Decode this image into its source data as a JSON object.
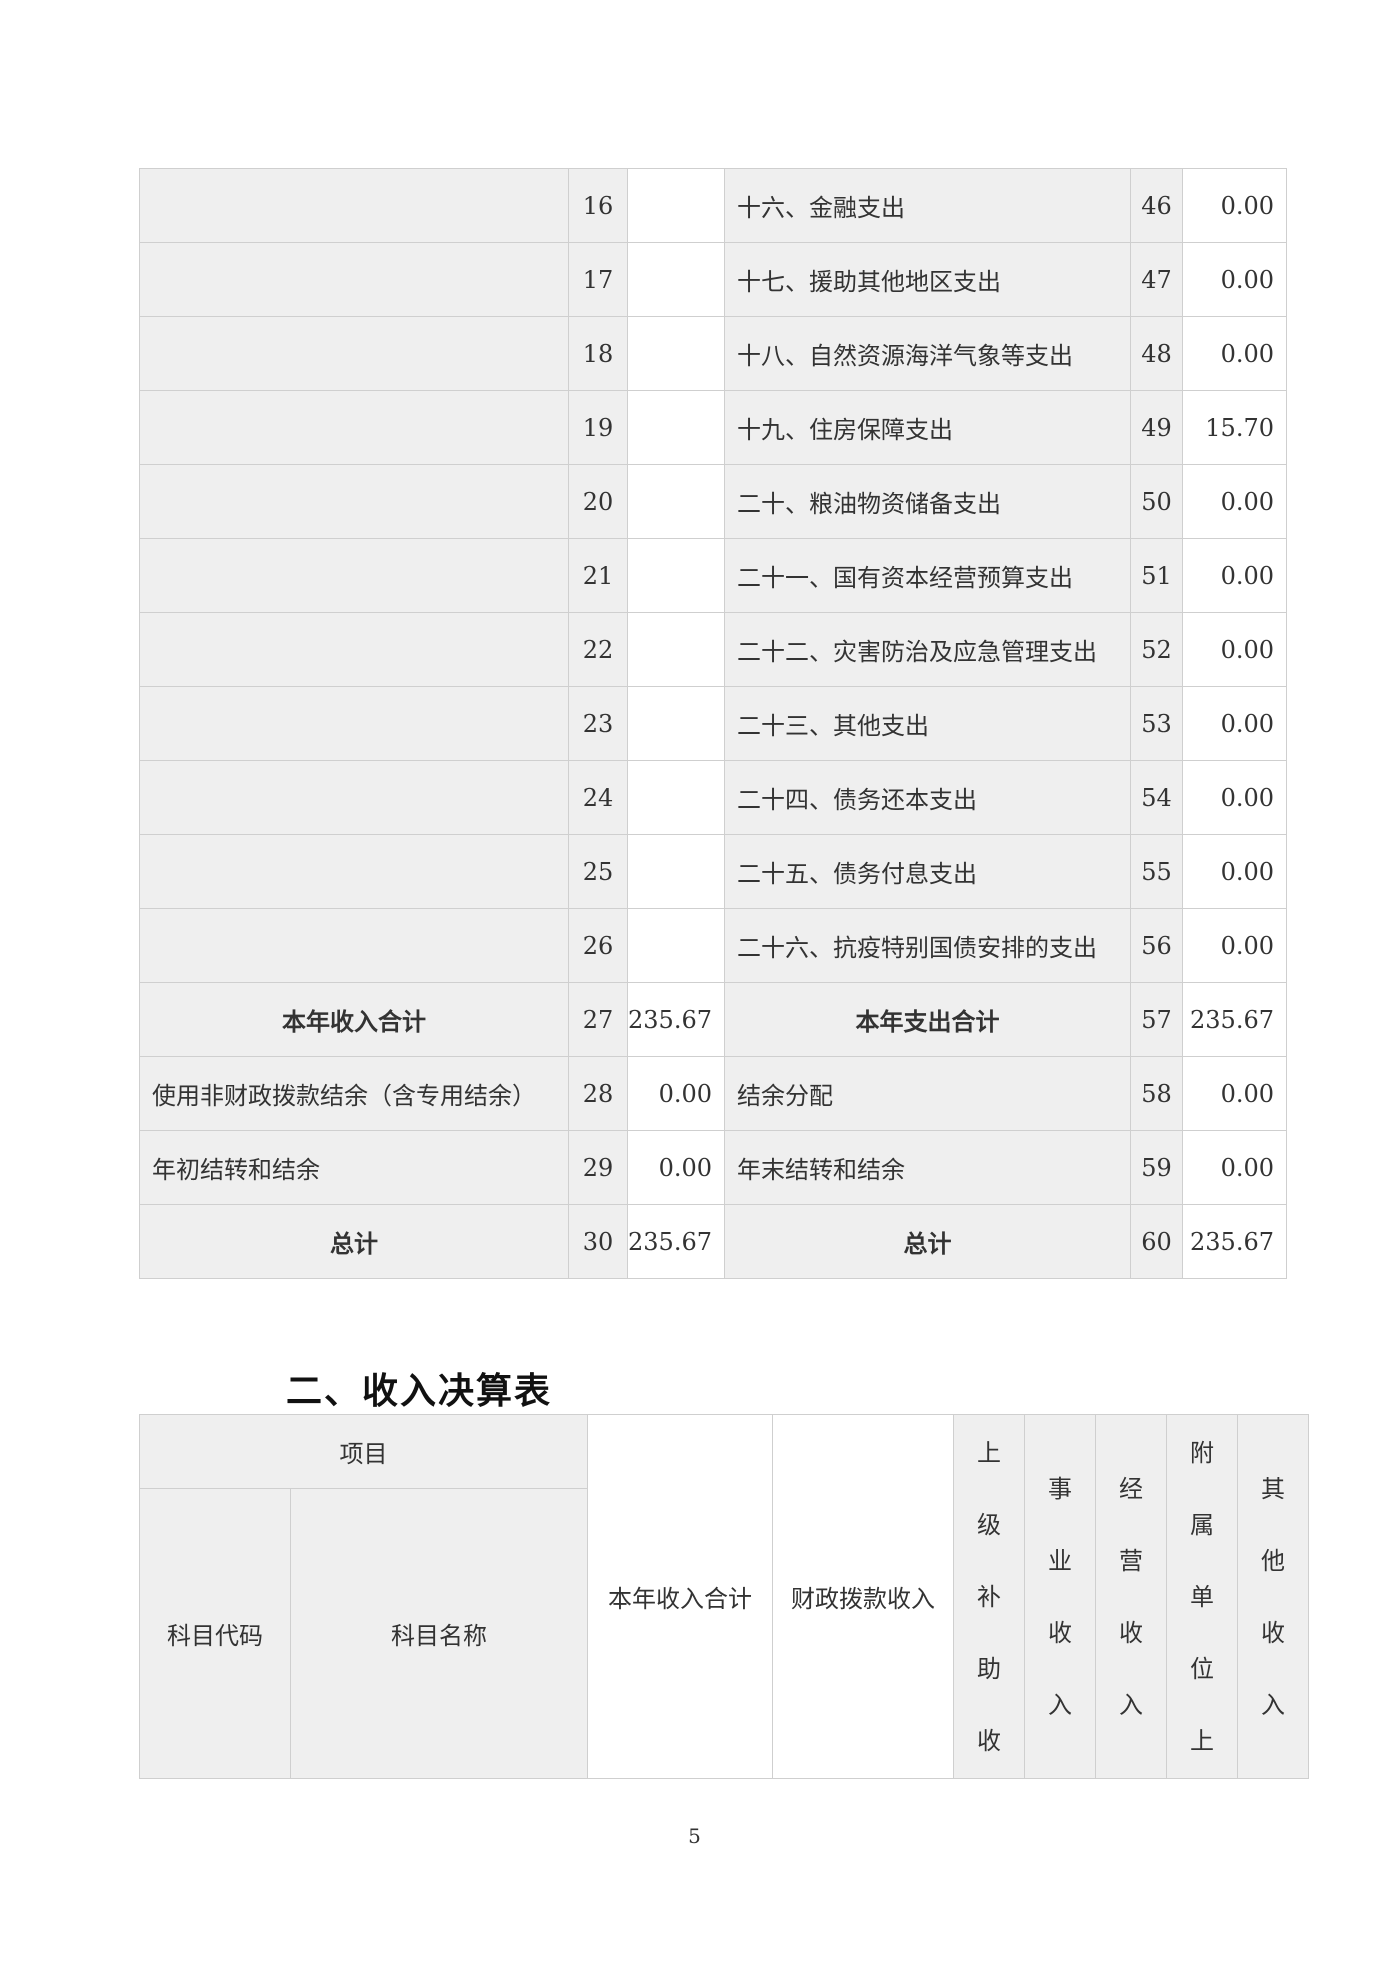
{
  "table1": {
    "rows": [
      {
        "left_label": "",
        "left_no": "16",
        "left_amount": "",
        "right_label": "十六、金融支出",
        "right_no": "46",
        "right_amount": "0.00"
      },
      {
        "left_label": "",
        "left_no": "17",
        "left_amount": "",
        "right_label": "十七、援助其他地区支出",
        "right_no": "47",
        "right_amount": "0.00"
      },
      {
        "left_label": "",
        "left_no": "18",
        "left_amount": "",
        "right_label": "十八、自然资源海洋气象等支出",
        "right_no": "48",
        "right_amount": "0.00"
      },
      {
        "left_label": "",
        "left_no": "19",
        "left_amount": "",
        "right_label": "十九、住房保障支出",
        "right_no": "49",
        "right_amount": "15.70"
      },
      {
        "left_label": "",
        "left_no": "20",
        "left_amount": "",
        "right_label": "二十、粮油物资储备支出",
        "right_no": "50",
        "right_amount": "0.00"
      },
      {
        "left_label": "",
        "left_no": "21",
        "left_amount": "",
        "right_label": "二十一、国有资本经营预算支出",
        "right_no": "51",
        "right_amount": "0.00"
      },
      {
        "left_label": "",
        "left_no": "22",
        "left_amount": "",
        "right_label": "二十二、灾害防治及应急管理支出",
        "right_no": "52",
        "right_amount": "0.00"
      },
      {
        "left_label": "",
        "left_no": "23",
        "left_amount": "",
        "right_label": "二十三、其他支出",
        "right_no": "53",
        "right_amount": "0.00"
      },
      {
        "left_label": "",
        "left_no": "24",
        "left_amount": "",
        "right_label": "二十四、债务还本支出",
        "right_no": "54",
        "right_amount": "0.00"
      },
      {
        "left_label": "",
        "left_no": "25",
        "left_amount": "",
        "right_label": "二十五、债务付息支出",
        "right_no": "55",
        "right_amount": "0.00"
      },
      {
        "left_label": "",
        "left_no": "26",
        "left_amount": "",
        "right_label": "二十六、抗疫特别国债安排的支出",
        "right_no": "56",
        "right_amount": "0.00"
      },
      {
        "left_label": "本年收入合计",
        "left_no": "27",
        "left_amount": "235.67",
        "right_label": "本年支出合计",
        "right_no": "57",
        "right_amount": "235.67",
        "bold": true
      },
      {
        "left_label": "使用非财政拨款结余（含专用结余）",
        "left_no": "28",
        "left_amount": "0.00",
        "right_label": "结余分配",
        "right_no": "58",
        "right_amount": "0.00"
      },
      {
        "left_label": "年初结转和结余",
        "left_no": "29",
        "left_amount": "0.00",
        "right_label": "年末结转和结余",
        "right_no": "59",
        "right_amount": "0.00"
      },
      {
        "left_label": "总计",
        "left_no": "30",
        "left_amount": "235.67",
        "right_label": "总计",
        "right_no": "60",
        "right_amount": "235.67",
        "bold": true
      }
    ]
  },
  "section_title": "二、收入决算表",
  "table2": {
    "project": "项目",
    "code": "科目代码",
    "name": "科目名称",
    "total": "本年收入合计",
    "fiscal": "财政拨款收入",
    "vertical_headers": [
      [
        "上",
        "级",
        "补",
        "助",
        "收"
      ],
      [
        "事",
        "业",
        "收",
        "入"
      ],
      [
        "经",
        "营",
        "收",
        "入"
      ],
      [
        "附",
        "属",
        "单",
        "位",
        "上"
      ],
      [
        "其",
        "他",
        "收",
        "入"
      ]
    ]
  },
  "page_number": "5"
}
